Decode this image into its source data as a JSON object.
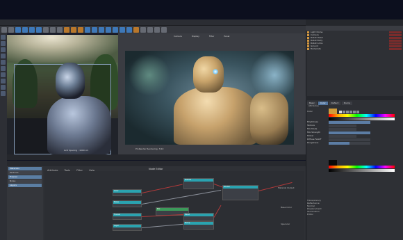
{
  "menubar": {
    "items": [
      "File",
      "Edit",
      "Create",
      "Select",
      "Tools",
      "Mesh",
      "Snap",
      "Animate",
      "Simulate",
      "Render",
      "Sculpt",
      "Motion Tracker",
      "Character",
      "Pipeline",
      "Plugins",
      "Script",
      "Window",
      "Help"
    ]
  },
  "viewport_left": {
    "caption": "Grid Spacing : 1000 cm"
  },
  "viewport_right": {
    "header": [
      "Camera",
      "Display",
      "Filter",
      "Panel"
    ],
    "footer_label": "ProRender Rendering: 3/10"
  },
  "status_bar": {
    "text": "Frame Time: 00:00:00  Progress: 100%  Resolution: 960 x 540"
  },
  "node_editor": {
    "menu": [
      "Create",
      "Edit",
      "View",
      "Attribute",
      "Tools",
      "Filter",
      "Help"
    ],
    "title": "Node Editor",
    "left_items": [
      "Materials",
      "Textures",
      "Fresnel",
      "Noise",
      "Layers"
    ],
    "right_labels": [
      "Material Output",
      "Base Color",
      "Specular"
    ],
    "node_labels": [
      "Color",
      "Noise",
      "Fresnel",
      "Layer",
      "Texture",
      "Mix",
      "Blend",
      "Bump",
      "Shader"
    ]
  },
  "object_manager": {
    "header": [
      "File",
      "Edit",
      "View",
      "Objects",
      "Tags",
      "Bookmarks"
    ],
    "objects": [
      "Light Dome",
      "Camera",
      "Robot Head",
      "Robot Body",
      "Robot Arms",
      "Ground",
      "Backplate"
    ]
  },
  "attributes": {
    "header": "Attributes",
    "tabs": [
      "Basic",
      "Color",
      "Reflect",
      "Bump"
    ],
    "rows": [
      "Color",
      "Brightness",
      "Texture",
      "Mix Mode",
      "Mix Strength",
      "Model",
      "Diffuse Falloff",
      "Roughness"
    ],
    "sections": [
      "Transparency",
      "Reflectance",
      "Normal",
      "Displacement",
      "Illumination",
      "Editor"
    ]
  },
  "colors": {
    "accent": "#5577a0",
    "node_header": "#4aa9a4",
    "node_header_green": "#3c9a5a",
    "wire": "#b23a3a",
    "swatch": "#d19640"
  }
}
